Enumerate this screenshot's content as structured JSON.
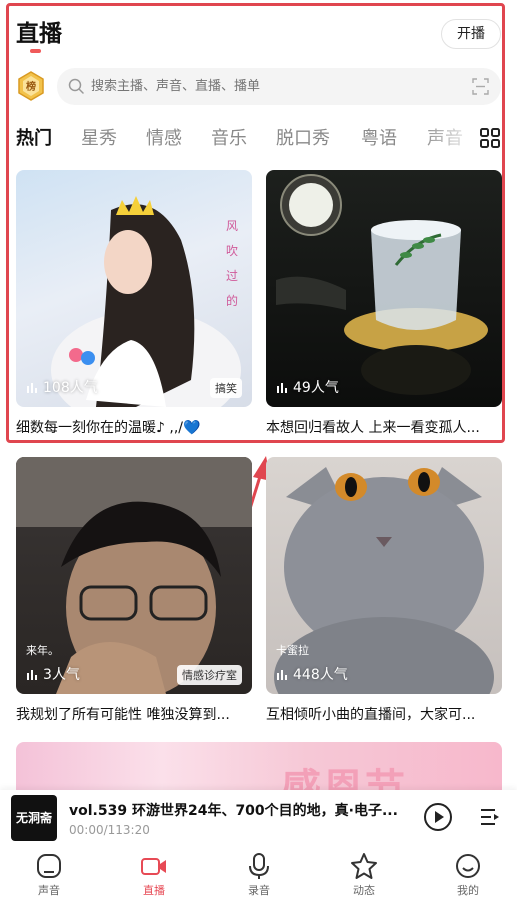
{
  "header": {
    "title": "直播",
    "live_button": "开播"
  },
  "rank_badge": "榜",
  "search": {
    "placeholder": "搜索主播、声音、直播、播单"
  },
  "tabs": [
    {
      "label": "热门",
      "active": true
    },
    {
      "label": "星秀"
    },
    {
      "label": "情感"
    },
    {
      "label": "音乐"
    },
    {
      "label": "脱口秀"
    },
    {
      "label": "粤语"
    },
    {
      "label": "声音"
    }
  ],
  "cards": [
    {
      "title": "细数每一刻你在的温暖♪ ,,/💙",
      "popularity": "108人气",
      "tag": "搞笑"
    },
    {
      "title": "本想回归看故人 上来一看变孤人...",
      "popularity": "49人气"
    },
    {
      "title": "我规划了所有可能性 唯独没算到...",
      "popularity": "3人气",
      "tag": "情感诊疗室",
      "nick": "来年。"
    },
    {
      "title": "互相倾听小曲的直播间，大家可...",
      "popularity": "448人气",
      "nick": "卡蜜拉"
    }
  ],
  "banner": {
    "text": "感恩节"
  },
  "player": {
    "cover_text": "无洞斋",
    "title": "vol.539 环游世界24年、700个目的地，真·电子...",
    "time": "00:00/113:20"
  },
  "nav": [
    {
      "label": "声音",
      "icon": "home-icon"
    },
    {
      "label": "直播",
      "icon": "live-camera-icon",
      "active": true
    },
    {
      "label": "录音",
      "icon": "microphone-icon"
    },
    {
      "label": "动态",
      "icon": "star-icon"
    },
    {
      "label": "我的",
      "icon": "profile-icon"
    }
  ],
  "colors": {
    "accent": "#e74a55",
    "highlight_border": "#e0464f"
  }
}
